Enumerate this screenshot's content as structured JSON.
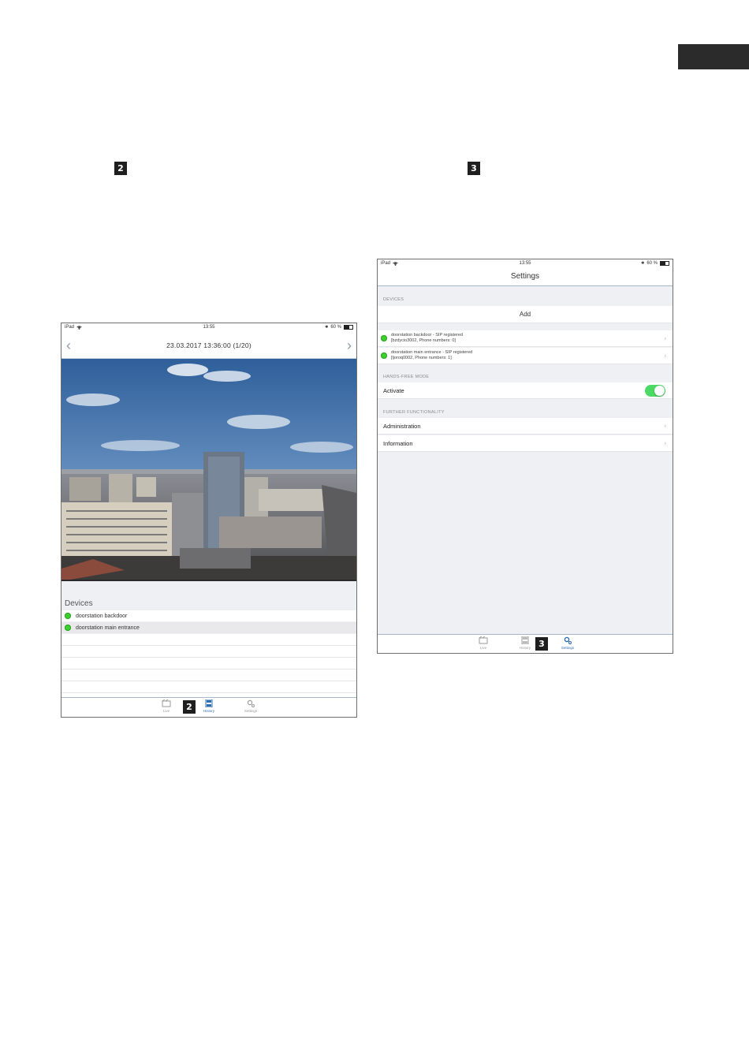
{
  "page": {
    "badges": {
      "step_2": "2",
      "step_3": "3"
    }
  },
  "history_screen": {
    "statusbar": {
      "carrier": "iPad",
      "time": "13:55",
      "battery": "60 %"
    },
    "nav": {
      "prev_icon": "chevron-left-icon",
      "date": "23.03.2017 13:36:00 (1/20)",
      "next_icon": "chevron-right-icon"
    },
    "devices_header": "Devices",
    "devices": [
      {
        "name": "doorstation backdoor",
        "status_color": "#3dd12f"
      },
      {
        "name": "doorstation main entrance",
        "status_color": "#3dd12f"
      }
    ],
    "tabs": [
      {
        "label": "Live",
        "icon": "live-icon"
      },
      {
        "label": "History",
        "icon": "history-icon",
        "active": true
      },
      {
        "label": "Settings",
        "icon": "gear-icon"
      }
    ],
    "tab_badge": "2"
  },
  "settings_screen": {
    "statusbar": {
      "carrier": "iPad",
      "time": "13:55",
      "battery": "60 %"
    },
    "title": "Settings",
    "devices_group": {
      "header": "Devices",
      "add_label": "Add",
      "items": [
        {
          "line1": "doorstation backdoor - SIP registered",
          "line2": "[bzdycio3002, Phone numbers: 0]"
        },
        {
          "line1": "doorstation main entrance - SIP registered",
          "line2": "[ljoroq0002, Phone numbers: 1]"
        }
      ]
    },
    "handsfree_group": {
      "header": "Hands-free mode",
      "activate_label": "Activate",
      "enabled": true
    },
    "further_group": {
      "header": "Further functionality",
      "items": [
        "Administration",
        "Information"
      ]
    },
    "tabs": [
      {
        "label": "Live",
        "icon": "live-icon"
      },
      {
        "label": "History",
        "icon": "history-icon"
      },
      {
        "label": "Settings",
        "icon": "gear-icon",
        "active": true
      }
    ],
    "tab_badge": "3"
  },
  "colors": {
    "accent": "#2f6fb0",
    "online": "#3dd12f",
    "toggle_on": "#4cd964"
  }
}
